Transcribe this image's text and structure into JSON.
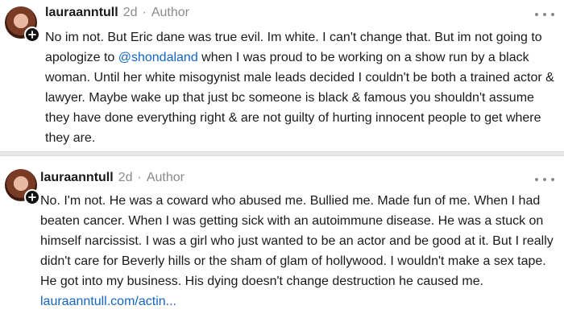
{
  "comments": [
    {
      "username": "lauraanntull",
      "age": "2d",
      "separator": "·",
      "role": "Author",
      "text_before_mention": "No im not. But Eric dane was true evil. Im white. I can't change that. But im not going to apologize to ",
      "mention": "@shondaland",
      "text_after_mention": " when I was proud to be working on a show run by a black woman. Until her white misogynist male leads decided I couldn't be both a trained actor & lawyer. Maybe wake up that just bc someone is black & famous you shouldn't assume they have done everything right & are not guilty of hurting innocent people to get where they are."
    },
    {
      "username": "lauraanntull",
      "age": "2d",
      "separator": "·",
      "role": "Author",
      "text": "No. I'm not. He was a coward who abused me. Bullied me. Made fun of me. When I had beaten cancer. When I was getting sick with an autoimmune disease. He was a stuck on himself narcissist. I was a girl who just wanted to be an actor and be good at it. But I really didn't care for Beverly hills or the sham of glam of hollywood. I wouldn't make a sex tape. He got into my business. His dying doesn't change destruction he caused me. ",
      "link": "lauraanntull.com/actin..."
    }
  ],
  "icons": {
    "avatar": "avatar",
    "follow": "plus-icon",
    "more": "more-options-icon"
  },
  "colors": {
    "link": "#1565c0",
    "meta": "#8a8a8a",
    "background": "#ffffff",
    "divider": "#e9e9e9"
  }
}
